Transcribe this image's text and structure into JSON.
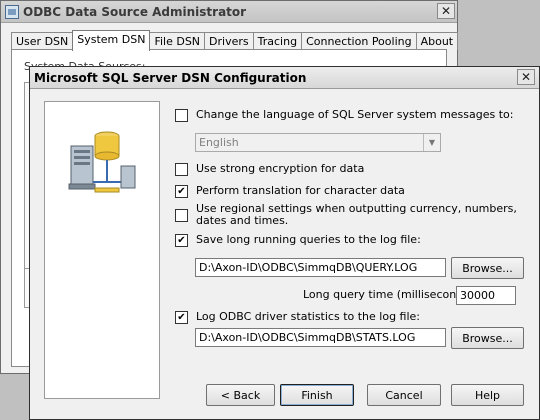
{
  "odbc_window": {
    "title": "ODBC Data Source Administrator",
    "tabs": [
      "User DSN",
      "System DSN",
      "File DSN",
      "Drivers",
      "Tracing",
      "Connection Pooling",
      "About"
    ],
    "active_tab": "System DSN",
    "panel_label": "System Data Sources:"
  },
  "dsn_dialog": {
    "title": "Microsoft SQL Server DSN Configuration",
    "close_glyph": "✕",
    "options": {
      "change_language": {
        "label": "Change the language of SQL Server system messages to:",
        "checked": false
      },
      "language_value": "English",
      "strong_encryption": {
        "label": "Use strong encryption for data",
        "checked": false
      },
      "char_translation": {
        "label": "Perform translation for character data",
        "checked": true
      },
      "regional_settings": {
        "label": "Use regional settings when outputting currency, numbers, dates and times.",
        "checked": false
      },
      "long_queries": {
        "label": "Save long running queries to the log file:",
        "checked": true
      },
      "long_query_path": "D:\\Axon-ID\\ODBC\\SimmqDB\\QUERY.LOG",
      "long_query_time_label": "Long query time (milliseconds):",
      "long_query_time_value": "30000",
      "driver_stats": {
        "label": "Log ODBC driver statistics to the log file:",
        "checked": true
      },
      "stats_path": "D:\\Axon-ID\\ODBC\\SimmqDB\\STATS.LOG"
    },
    "buttons": {
      "browse1": "Browse...",
      "browse2": "Browse...",
      "back": "< Back",
      "finish": "Finish",
      "cancel": "Cancel",
      "help": "Help"
    },
    "check_glyph": "✔"
  }
}
